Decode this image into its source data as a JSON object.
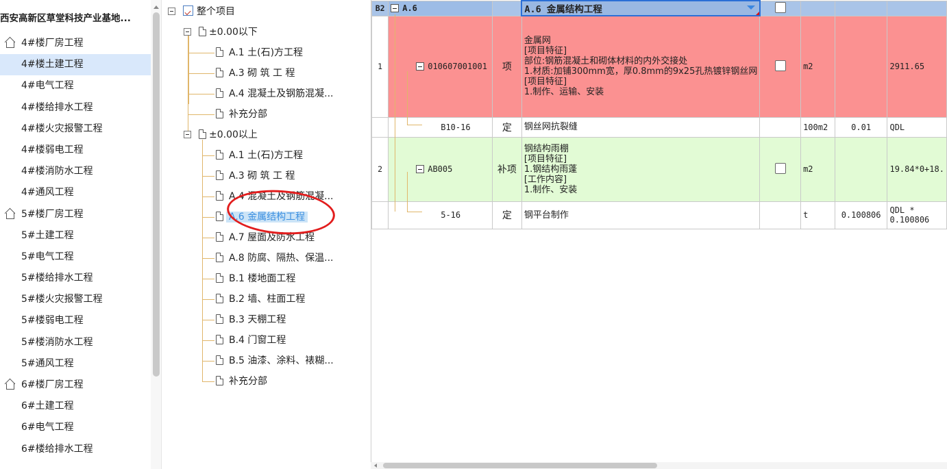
{
  "left_panel": {
    "project_title": "西安高新区草堂科技产业基地...",
    "groups": [
      {
        "label": "4#楼厂房工程",
        "children": [
          "4#楼土建工程",
          "4#电气工程",
          "4#楼给排水工程",
          "4#楼火灾报警工程",
          "4#楼弱电工程",
          "4#楼消防水工程",
          "4#通风工程"
        ]
      },
      {
        "label": "5#楼厂房工程",
        "children": [
          "5#土建工程",
          "5#电气工程",
          "5#楼给排水工程",
          "5#楼火灾报警工程",
          "5#楼弱电工程",
          "5#楼消防水工程",
          "5#通风工程"
        ]
      },
      {
        "label": "6#楼厂房工程",
        "children": [
          "6#土建工程",
          "6#电气工程",
          "6#楼给排水工程"
        ]
      }
    ],
    "selected": "4#楼土建工程"
  },
  "tree": {
    "root": "整个项目",
    "below_zero": {
      "label": "±0.00以下",
      "items": [
        "A.1  土(石)方工程",
        "A.3  砌 筑 工 程",
        "A.4  混凝土及钢筋混凝...",
        "补充分部"
      ]
    },
    "above_zero": {
      "label": "±0.00以上",
      "items": [
        "A.1  土(石)方工程",
        "A.3  砌 筑 工 程",
        "A.4  混凝土及钢筋混凝...",
        "A.6  金属结构工程",
        "A.7  屋面及防水工程",
        "A.8  防腐、隔热、保温...",
        "B.1  楼地面工程",
        "B.2  墙、柱面工程",
        "B.3  天棚工程",
        "B.4  门窗工程",
        "B.5  油漆、涂料、裱糊...",
        "补充分部"
      ]
    },
    "selected": "A.6  金属结构工程"
  },
  "grid": {
    "header": {
      "level": "B2",
      "code": "A.6",
      "name": "A.6  金属结构工程"
    },
    "rows": [
      {
        "no": "1",
        "code": "010607001001",
        "type": "项",
        "desc": [
          "金属网",
          "[项目特征]",
          "部位:钢筋混凝土和砌体材料的内外交接处",
          "1.材质:加铺300mm宽，厚0.8mm的9x25孔热镀锌钢丝网",
          "[项目特征]",
          "1.制作、运输、安装"
        ],
        "unit": "m2",
        "qty_expr": "",
        "qty": "2911.65"
      },
      {
        "no": "",
        "code": "B10-16",
        "type": "定",
        "desc": [
          "钢丝网抗裂缝"
        ],
        "unit": "100m2",
        "qty_expr": "0.01",
        "qty": "QDL"
      },
      {
        "no": "2",
        "code": "AB005",
        "type": "补项",
        "desc": [
          "钢结构雨棚",
          "[项目特征]",
          "1.钢结构雨蓬",
          "[工作内容]",
          "1.制作、安装"
        ],
        "unit": "m2",
        "qty_expr": "",
        "qty": "19.84*0+18."
      },
      {
        "no": "",
        "code": "5-16",
        "type": "定",
        "desc": [
          "钢平台制作"
        ],
        "unit": "t",
        "qty_expr": "0.100806",
        "qty": "QDL *",
        "qty_line2": "0.100806"
      }
    ]
  },
  "colors": {
    "selection": "#d9e8fb",
    "tree_selection_text": "#3b8fe0",
    "header_row": "#a9c4e8",
    "row_red": "#fb9191",
    "row_green": "#e2fbd5",
    "annotation_circle": "#e21d1d",
    "tree_line": "#e0b66a"
  },
  "icons": {
    "group": "home-icon",
    "tree_item": "document-icon",
    "root": "project-icon",
    "expander": "minus-expander-icon"
  }
}
